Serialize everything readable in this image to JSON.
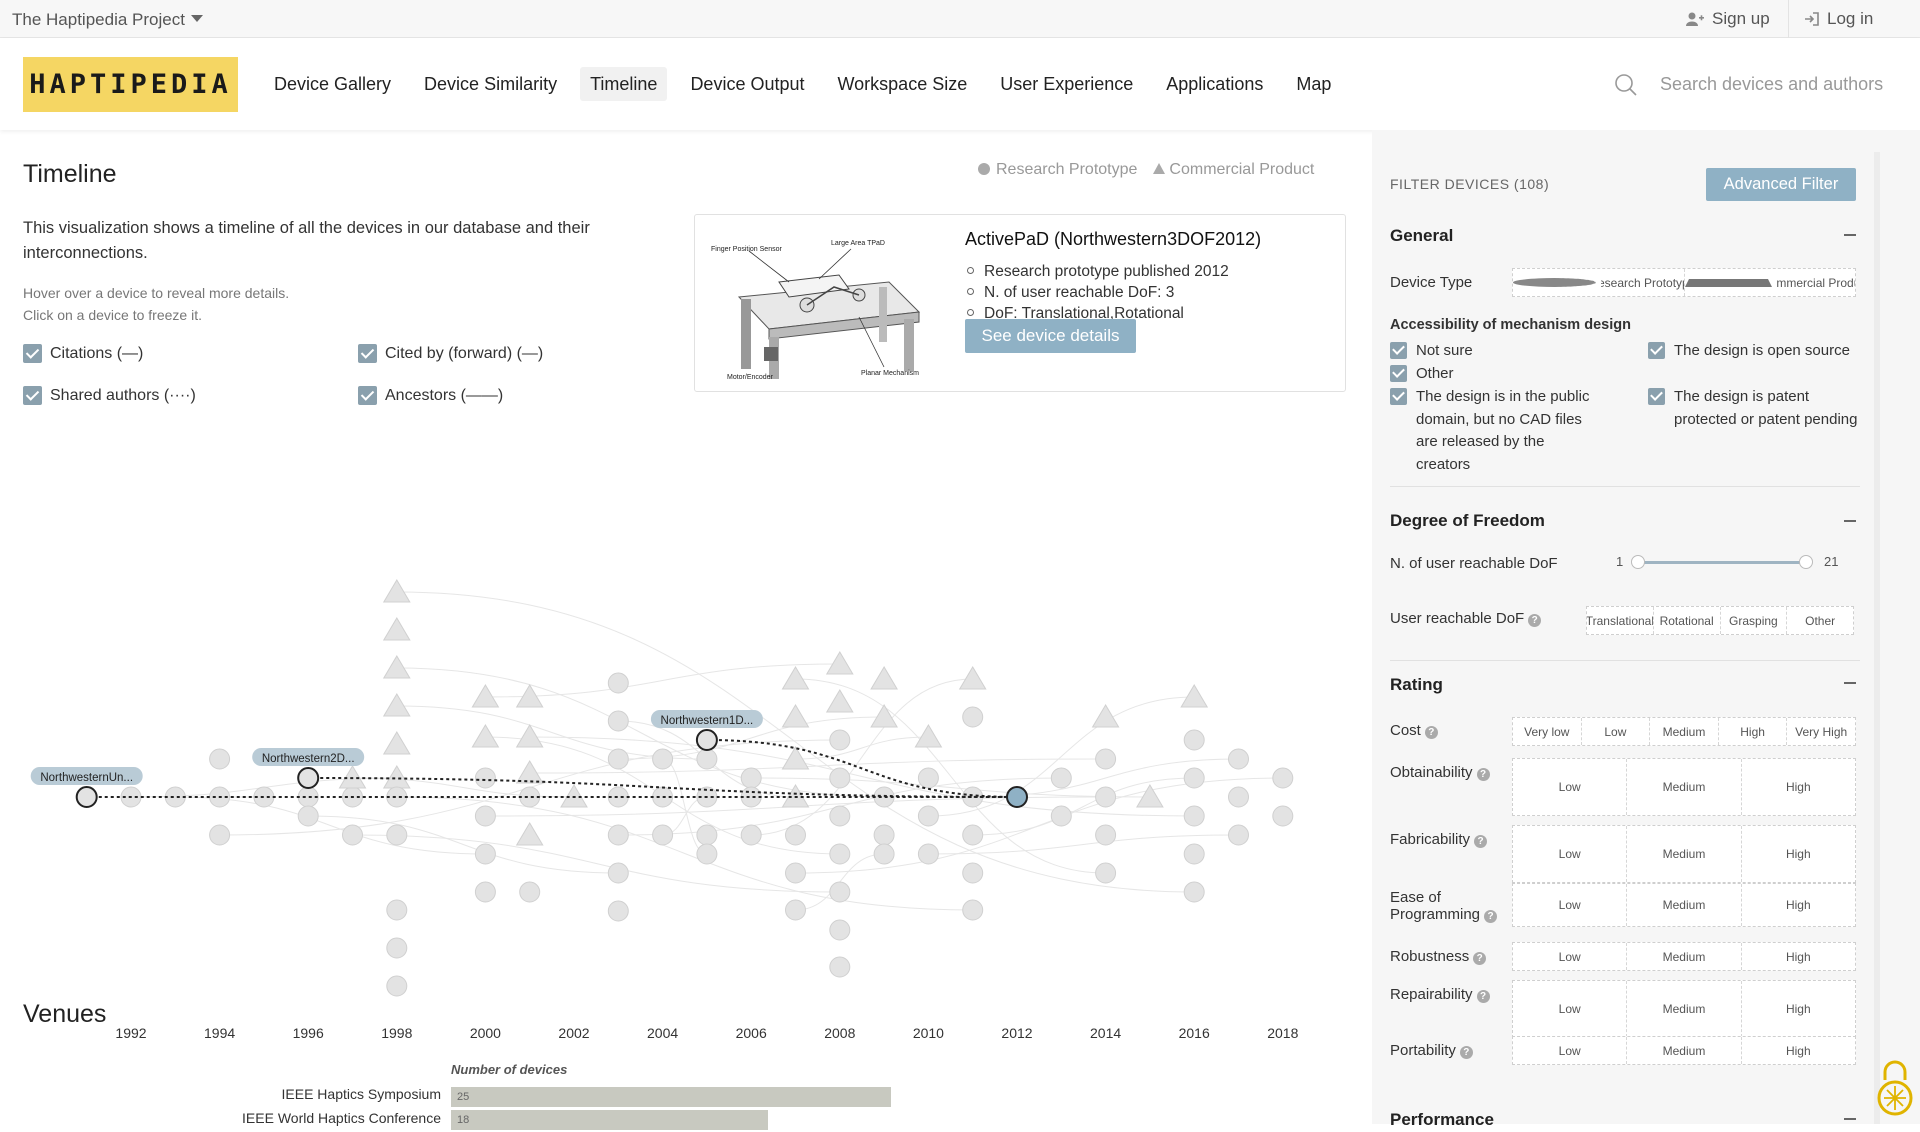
{
  "topbar": {
    "project": "The Haptipedia Project",
    "signup": "Sign up",
    "login": "Log in"
  },
  "header": {
    "logo": "HAPTIPEDIA",
    "nav": [
      "Device Gallery",
      "Device Similarity",
      "Timeline",
      "Device Output",
      "Workspace Size",
      "User Experience",
      "Applications",
      "Map"
    ],
    "active_nav": "Timeline",
    "search_placeholder": "Search devices and authors"
  },
  "main": {
    "title": "Timeline",
    "legend": {
      "research": "Research Prototype",
      "commercial": "Commercial Product"
    },
    "description": "This visualization shows a timeline of all the devices in our database and their interconnections.",
    "hint1": "Hover over a device to reveal more details.",
    "hint2": "Click on a device to freeze it.",
    "checkboxes": {
      "citations": "Citations (—)",
      "cited_by": "Cited by (forward) (—)",
      "shared_authors": "Shared authors (····)",
      "ancestors": "Ancestors (——)"
    },
    "card": {
      "title": "ActivePaD (Northwestern3DOF2012)",
      "items": [
        "Research prototype published 2012",
        "N. of user reachable DoF: 3",
        "DoF: Translational,Rotational"
      ],
      "button": "See device details",
      "img_labels": [
        "Finger Position Sensor",
        "Large Area TPaD",
        "Planar Mechanism",
        "Motor/Encoder"
      ]
    },
    "timeline": {
      "years": [
        "1992",
        "1994",
        "1996",
        "1998",
        "2000",
        "2002",
        "2004",
        "2006",
        "2008",
        "2010",
        "2012",
        "2014",
        "2016",
        "2018"
      ],
      "labels": [
        "NorthwesternUn...",
        "Northwestern2D...",
        "Northwestern1D..."
      ]
    },
    "venues": {
      "title": "Venues",
      "axis_label": "Number of devices",
      "rows": [
        {
          "name": "IEEE Haptics Symposium",
          "value": 25
        },
        {
          "name": "IEEE World Haptics Conference",
          "value": 18
        }
      ]
    }
  },
  "sidebar": {
    "filter_label": "FILTER DEVICES (108)",
    "advanced_button": "Advanced Filter",
    "general": {
      "title": "General",
      "device_type_label": "Device Type",
      "device_type_options": [
        "Research Prototype",
        "Commercial Product"
      ],
      "access_title": "Accessibility of mechanism design",
      "access_options": [
        "Not sure",
        "Other",
        "The design is in the public domain, but no CAD files are released by the creators",
        "The design is open source",
        "The design is patent protected or patent pending"
      ]
    },
    "dof": {
      "title": "Degree of Freedom",
      "reachable_label": "N. of user reachable DoF",
      "min": "1",
      "max": "21",
      "user_dof_label": "User reachable DoF",
      "user_dof_options": [
        "Translational",
        "Rotational",
        "Grasping",
        "Other"
      ]
    },
    "rating": {
      "title": "Rating",
      "cost_label": "Cost",
      "cost_options": [
        "Very low",
        "Low",
        "Medium",
        "High",
        "Very High"
      ],
      "rows": [
        "Obtainability",
        "Fabricability",
        "Ease of Programming",
        "Robustness",
        "Repairability",
        "Portability"
      ],
      "options": [
        "Low",
        "Medium",
        "High"
      ]
    },
    "performance": {
      "title": "Performance"
    }
  }
}
